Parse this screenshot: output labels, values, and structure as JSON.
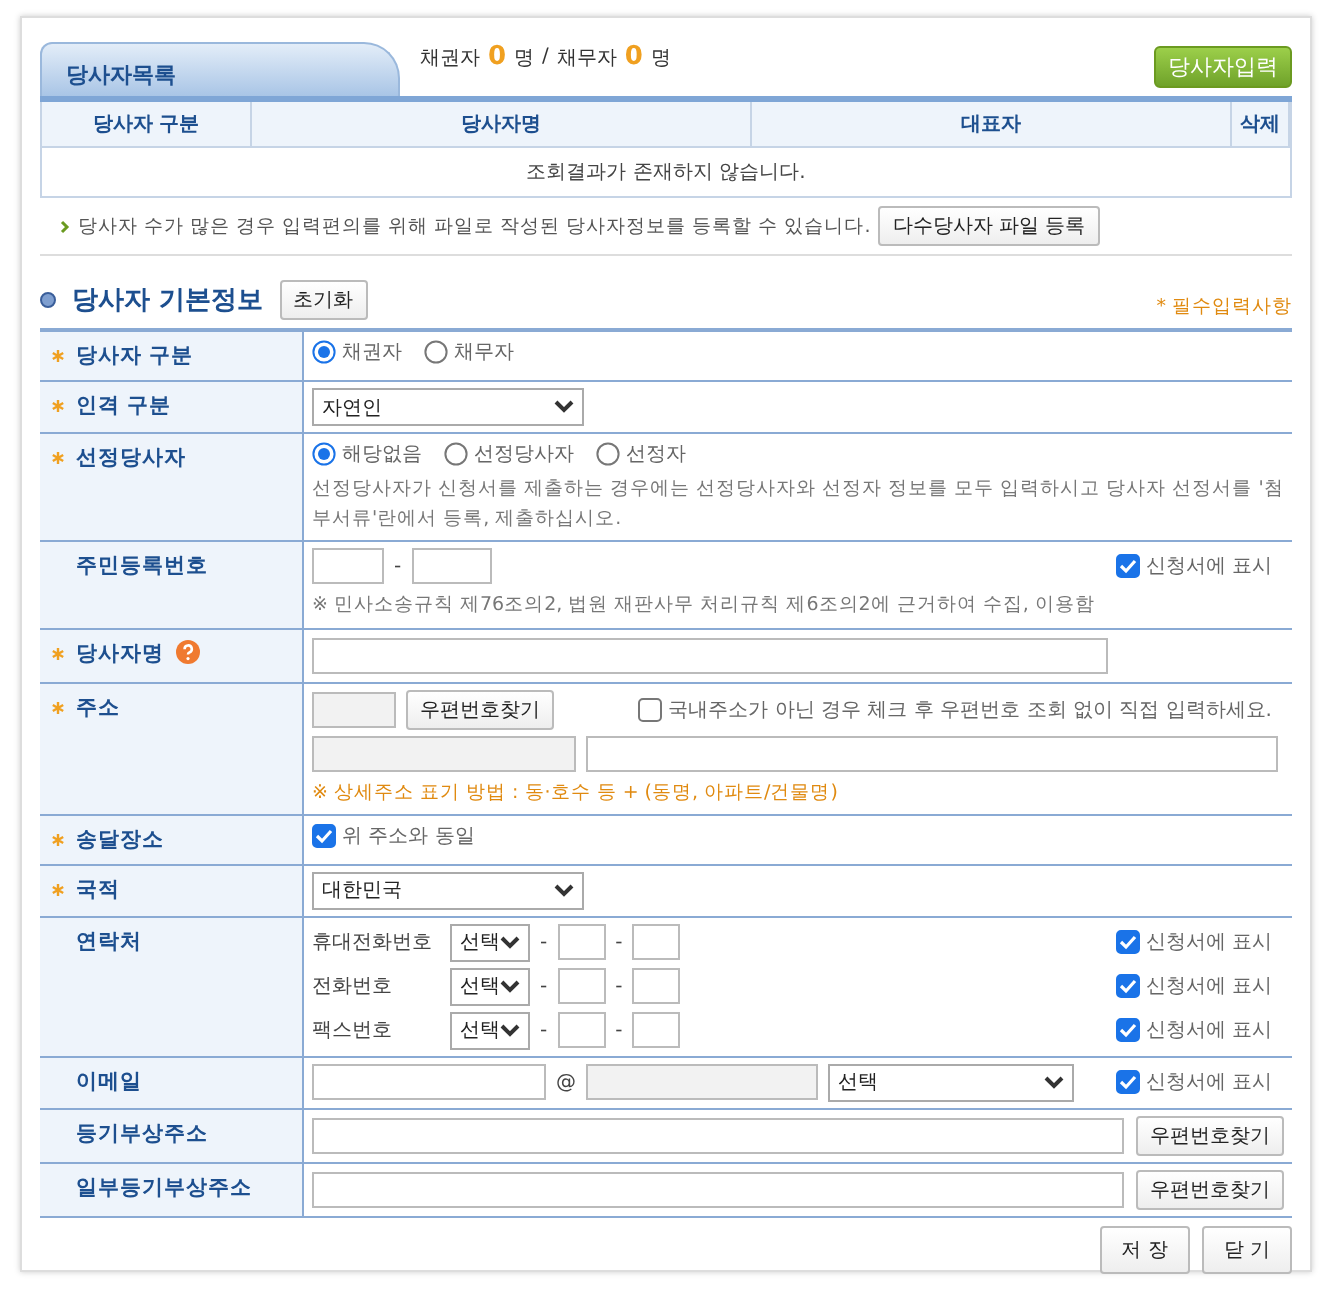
{
  "list_tab": {
    "title": "당사자목록"
  },
  "counts": [
    {
      "label": "채권자",
      "count": "0",
      "unit": "명"
    },
    {
      "label": "채무자",
      "count": "0",
      "unit": "명"
    }
  ],
  "count_separator": "/",
  "add_party_button": "당사자입력",
  "party_table": {
    "columns": [
      "당사자 구분",
      "당사자명",
      "대표자",
      "삭제"
    ],
    "empty_message": "조회결과가 존재하지 않습니다."
  },
  "bulk_info": {
    "text": "당사자 수가 많은 경우 입력편의를 위해 파일로 작성된 당사자정보를 등록할 수 있습니다.",
    "button": "다수당사자 파일 등록"
  },
  "section": {
    "title": "당사자 기본정보",
    "reset_button": "초기화",
    "required_note": "* 필수입력사항"
  },
  "form_rows": [
    {
      "kind": "radio",
      "label": "당사자 구분",
      "required": true,
      "options": [
        {
          "label": "채권자",
          "selected": true
        },
        {
          "label": "채무자",
          "selected": false
        }
      ]
    },
    {
      "kind": "select",
      "label": "인격 구분",
      "required": true,
      "value": "자연인"
    },
    {
      "kind": "radio",
      "label": "선정당사자",
      "required": true,
      "options": [
        {
          "label": "해당없음",
          "selected": true
        },
        {
          "label": "선정당사자",
          "selected": false
        },
        {
          "label": "선정자",
          "selected": false
        }
      ],
      "note": "선정당사자가 신청서를 제출하는 경우에는 선정당사자와 선정자 정보를 모두 입력하시고 당사자 선정서를 '첨부서류'란에서 등록, 제출하십시오."
    },
    {
      "kind": "resident_number",
      "label": "주민등록번호",
      "required": false,
      "separator": "-",
      "show_option": {
        "label": "신청서에 표시",
        "checked": true
      },
      "note": "※ 민사소송규칙 제76조의2, 법원 재판사무 처리규칙 제6조의2에 근거하여 수집, 이용함"
    },
    {
      "kind": "text",
      "label": "당사자명",
      "required": true,
      "help": true
    },
    {
      "kind": "address",
      "label": "주소",
      "required": true,
      "zip_button": "우편번호찾기",
      "foreign_option": {
        "label": "국내주소가 아닌 경우 체크 후 우편번호 조회 없이 직접 입력하세요.",
        "checked": false
      },
      "note": "※ 상세주소 표기 방법 : 동·호수 등 + (동명, 아파트/건물명)"
    },
    {
      "kind": "checkbox",
      "label": "송달장소",
      "required": true,
      "option": {
        "label": "위 주소와 동일",
        "checked": true
      }
    },
    {
      "kind": "select",
      "label": "국적",
      "required": true,
      "value": "대한민국"
    },
    {
      "kind": "contacts",
      "label": "연락처",
      "required": false,
      "lines": [
        {
          "label": "휴대전화번호",
          "select": "선택",
          "separator": "-",
          "show_option": {
            "label": "신청서에 표시",
            "checked": true
          }
        },
        {
          "label": "전화번호",
          "select": "선택",
          "separator": "-",
          "show_option": {
            "label": "신청서에 표시",
            "checked": true
          }
        },
        {
          "label": "팩스번호",
          "select": "선택",
          "separator": "-",
          "show_option": {
            "label": "신청서에 표시",
            "checked": true
          }
        }
      ]
    },
    {
      "kind": "email",
      "label": "이메일",
      "required": false,
      "at": "@",
      "select": "선택",
      "show_option": {
        "label": "신청서에 표시",
        "checked": true
      }
    },
    {
      "kind": "text_button",
      "label": "등기부상주소",
      "required": false,
      "button": "우편번호찾기"
    },
    {
      "kind": "text_button",
      "label": "일부등기부상주소",
      "required": false,
      "button": "우편번호찾기"
    }
  ],
  "footer_buttons": [
    "저 장",
    "닫 기"
  ]
}
